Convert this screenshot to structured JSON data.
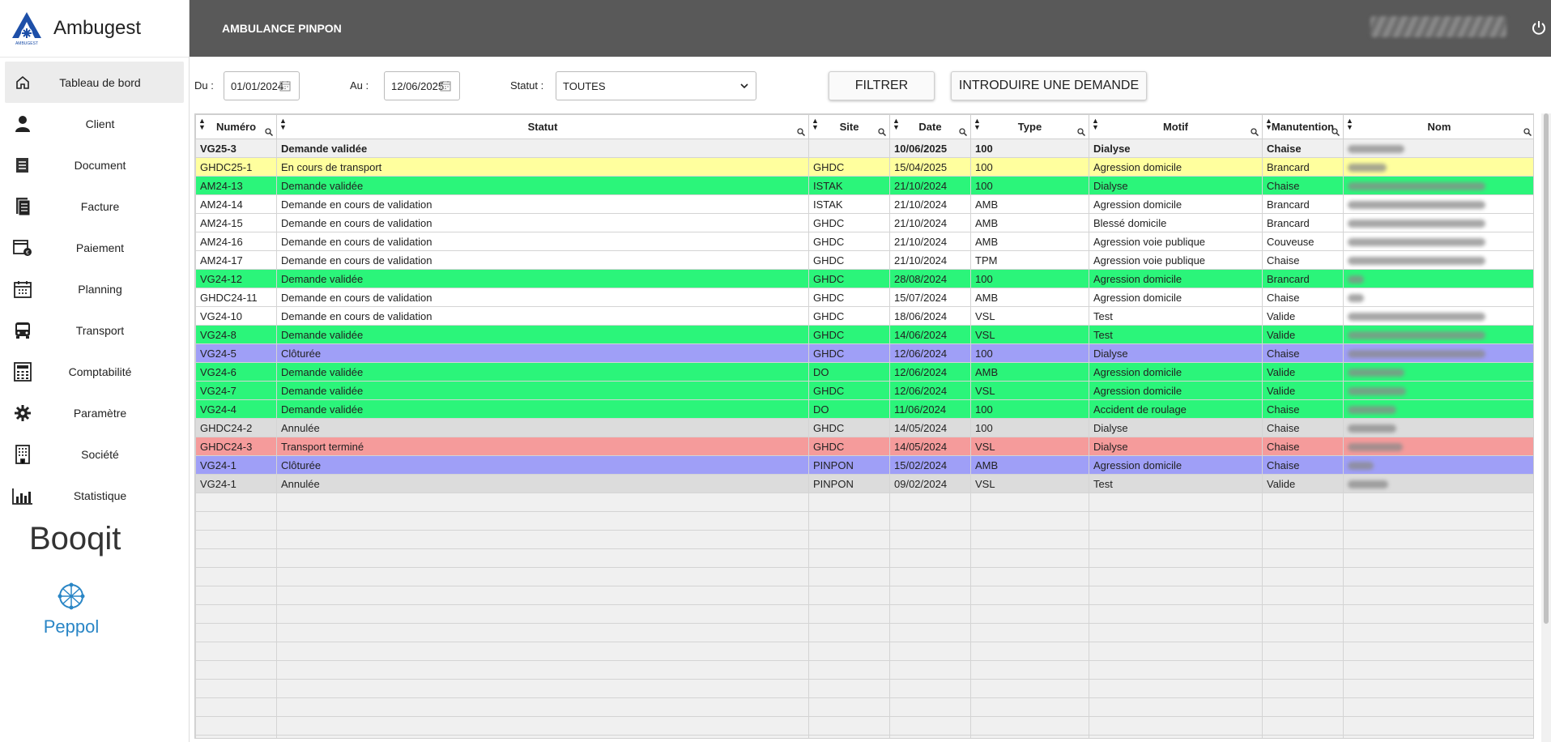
{
  "brand": {
    "name": "Ambugest",
    "logo_text": "AMBUGEST"
  },
  "header": {
    "title": "AMBULANCE PINPON",
    "power_icon": "power-icon"
  },
  "sidebar": {
    "items": [
      {
        "label": "Tableau de bord",
        "icon": "home-icon"
      },
      {
        "label": "Client",
        "icon": "user-icon"
      },
      {
        "label": "Document",
        "icon": "document-icon"
      },
      {
        "label": "Facture",
        "icon": "invoice-icon"
      },
      {
        "label": "Paiement",
        "icon": "payment-icon"
      },
      {
        "label": "Planning",
        "icon": "calendar-icon"
      },
      {
        "label": "Transport",
        "icon": "bus-icon"
      },
      {
        "label": "Comptabilité",
        "icon": "calculator-icon"
      },
      {
        "label": "Paramètre",
        "icon": "gear-icon"
      },
      {
        "label": "Société",
        "icon": "building-icon"
      },
      {
        "label": "Statistique",
        "icon": "chart-icon"
      }
    ],
    "partner1": "Booqit",
    "partner2": "Peppol"
  },
  "filters": {
    "du_label": "Du :",
    "du_value": "01/01/2024",
    "au_label": "Au :",
    "au_value": "12/06/2025",
    "statut_label": "Statut :",
    "statut_value": "TOUTES",
    "filter_button": "FILTRER",
    "new_request_button": "INTRODUIRE UNE DEMANDE"
  },
  "table": {
    "columns": [
      "Numéro",
      "Statut",
      "Site",
      "Date",
      "Type",
      "Motif",
      "Manutention",
      "Nom"
    ],
    "rows": [
      {
        "style": "row-bold",
        "cells": [
          "VG25-3",
          "Demande validée",
          "",
          "10/06/2025",
          "100",
          "Dialyse",
          "Chaise"
        ]
      },
      {
        "style": "yellow",
        "cells": [
          "GHDC25-1",
          "En cours de transport",
          "GHDC",
          "15/04/2025",
          "100",
          "Agression domicile",
          "Brancard"
        ]
      },
      {
        "style": "green",
        "cells": [
          "AM24-13",
          "Demande validée",
          "ISTAK",
          "21/10/2024",
          "100",
          "Dialyse",
          "Chaise"
        ]
      },
      {
        "style": "white",
        "cells": [
          "AM24-14",
          "Demande en cours de validation",
          "ISTAK",
          "21/10/2024",
          "AMB",
          "Agression domicile",
          "Brancard"
        ]
      },
      {
        "style": "white",
        "cells": [
          "AM24-15",
          "Demande en cours de validation",
          "GHDC",
          "21/10/2024",
          "AMB",
          "Blessé domicile",
          "Brancard"
        ]
      },
      {
        "style": "white",
        "cells": [
          "AM24-16",
          "Demande en cours de validation",
          "GHDC",
          "21/10/2024",
          "AMB",
          "Agression voie publique",
          "Couveuse"
        ]
      },
      {
        "style": "white",
        "cells": [
          "AM24-17",
          "Demande en cours de validation",
          "GHDC",
          "21/10/2024",
          "TPM",
          "Agression voie publique",
          "Chaise"
        ]
      },
      {
        "style": "green",
        "cells": [
          "VG24-12",
          "Demande validée",
          "GHDC",
          "28/08/2024",
          "100",
          "Agression domicile",
          "Brancard"
        ]
      },
      {
        "style": "white",
        "cells": [
          "GHDC24-11",
          "Demande en cours de validation",
          "GHDC",
          "15/07/2024",
          "AMB",
          "Agression domicile",
          "Chaise"
        ]
      },
      {
        "style": "white",
        "cells": [
          "VG24-10",
          "Demande en cours de validation",
          "GHDC",
          "18/06/2024",
          "VSL",
          "Test",
          "Valide"
        ]
      },
      {
        "style": "green",
        "cells": [
          "VG24-8",
          "Demande validée",
          "GHDC",
          "14/06/2024",
          "VSL",
          "Test",
          "Valide"
        ]
      },
      {
        "style": "purple",
        "cells": [
          "VG24-5",
          "Clôturée",
          "GHDC",
          "12/06/2024",
          "100",
          "Dialyse",
          "Chaise"
        ]
      },
      {
        "style": "green",
        "cells": [
          "VG24-6",
          "Demande validée",
          "DO",
          "12/06/2024",
          "AMB",
          "Agression domicile",
          "Valide"
        ]
      },
      {
        "style": "green",
        "cells": [
          "VG24-7",
          "Demande validée",
          "GHDC",
          "12/06/2024",
          "VSL",
          "Agression domicile",
          "Valide"
        ]
      },
      {
        "style": "green",
        "cells": [
          "VG24-4",
          "Demande validée",
          "DO",
          "11/06/2024",
          "100",
          "Accident de roulage",
          "Chaise"
        ]
      },
      {
        "style": "grey",
        "cells": [
          "GHDC24-2",
          "Annulée",
          "GHDC",
          "14/05/2024",
          "100",
          "Dialyse",
          "Chaise"
        ]
      },
      {
        "style": "red",
        "cells": [
          "GHDC24-3",
          "Transport terminé",
          "GHDC",
          "14/05/2024",
          "VSL",
          "Dialyse",
          "Chaise"
        ]
      },
      {
        "style": "purple",
        "cells": [
          "VG24-1",
          "Clôturée",
          "PINPON",
          "15/02/2024",
          "AMB",
          "Agression domicile",
          "Chaise"
        ]
      },
      {
        "style": "grey",
        "cells": [
          "VG24-1",
          "Annulée",
          "PINPON",
          "09/02/2024",
          "VSL",
          "Test",
          "Valide"
        ]
      }
    ],
    "colors": {
      "yellow": "#ffff9e",
      "green": "#2bf57a",
      "purple": "#9f9ff7",
      "grey": "#dcdcdc",
      "red": "#f59b9b",
      "header_bg": "#595959"
    }
  }
}
